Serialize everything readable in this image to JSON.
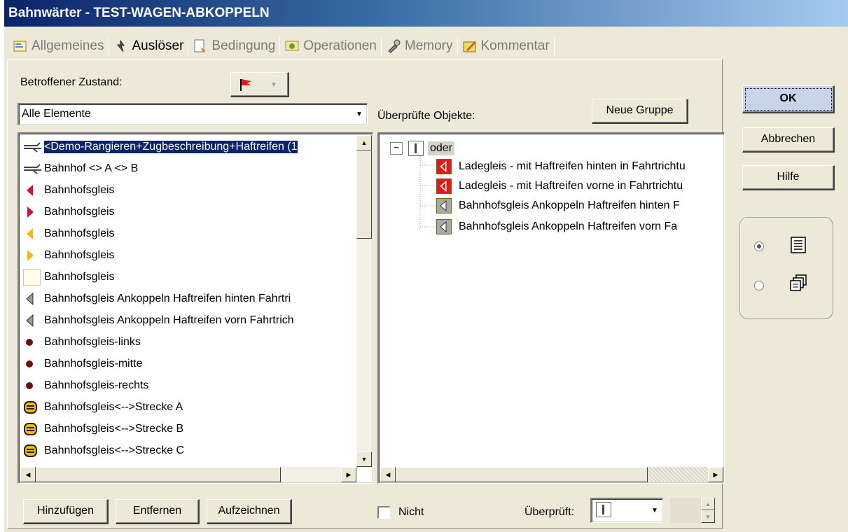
{
  "window": {
    "title": "Bahnwärter - TEST-WAGEN-ABKOPPELN"
  },
  "tabs": [
    {
      "label": "Allgemeines",
      "icon": "properties-icon",
      "active": false
    },
    {
      "label": "Auslöser",
      "icon": "trigger-icon",
      "active": true
    },
    {
      "label": "Bedingung",
      "icon": "condition-icon",
      "active": false
    },
    {
      "label": "Operationen",
      "icon": "operations-icon",
      "active": false
    },
    {
      "label": "Memory",
      "icon": "memory-icon",
      "active": false
    },
    {
      "label": "Kommentar",
      "icon": "comment-icon",
      "active": false
    }
  ],
  "left": {
    "state_label": "Betroffener Zustand:",
    "filter_value": "Alle Elemente",
    "items": [
      {
        "label": "<Demo-Rangieren+Zugbeschreibung+Haftreifen (1",
        "icon": "route-icon",
        "selected": true
      },
      {
        "label": "Bahnhof <> A <> B",
        "icon": "route-icon",
        "selected": false
      },
      {
        "label": "Bahnhofsgleis",
        "icon": "signal-left-red-icon",
        "selected": false
      },
      {
        "label": "Bahnhofsgleis",
        "icon": "signal-right-red-icon",
        "selected": false
      },
      {
        "label": "Bahnhofsgleis",
        "icon": "signal-left-yellow-icon",
        "selected": false
      },
      {
        "label": "Bahnhofsgleis",
        "icon": "signal-right-yellow-icon",
        "selected": false
      },
      {
        "label": "Bahnhofsgleis",
        "icon": "blank-box-icon",
        "selected": false
      },
      {
        "label": "Bahnhofsgleis  Ankoppeln Haftreifen hinten Fahrtri",
        "icon": "signal-left-gray-icon",
        "selected": false
      },
      {
        "label": "Bahnhofsgleis  Ankoppeln Haftreifen vorn Fahrtrich",
        "icon": "signal-left-gray-icon",
        "selected": false
      },
      {
        "label": "Bahnhofsgleis-links",
        "icon": "dot-icon",
        "selected": false
      },
      {
        "label": "Bahnhofsgleis-mitte",
        "icon": "dot-icon",
        "selected": false
      },
      {
        "label": "Bahnhofsgleis-rechts",
        "icon": "dot-icon",
        "selected": false
      },
      {
        "label": "Bahnhofsgleis<-->Strecke A",
        "icon": "block-arrow-icon",
        "selected": false
      },
      {
        "label": "Bahnhofsgleis<-->Strecke B",
        "icon": "block-arrow-icon",
        "selected": false
      },
      {
        "label": "Bahnhofsgleis<-->Strecke C",
        "icon": "block-arrow-icon",
        "selected": false
      }
    ],
    "buttons": {
      "add": "Hinzufügen",
      "remove": "Entfernen",
      "record": "Aufzeichnen"
    }
  },
  "right": {
    "checked_label": "Überprüfte Objekte:",
    "new_group_button": "Neue Gruppe",
    "tree_root": "oder",
    "tree_items": [
      {
        "label": "Ladegleis - mit Haftreifen hinten in Fahrtrichtu",
        "icon": "signal-red-icon"
      },
      {
        "label": "Ladegleis - mit Haftreifen vorne in Fahrtrichtu",
        "icon": "signal-red-icon"
      },
      {
        "label": "Bahnhofsgleis  Ankoppeln Haftreifen hinten F",
        "icon": "signal-gray-icon"
      },
      {
        "label": "Bahnhofsgleis  Ankoppeln Haftreifen vorn Fa",
        "icon": "signal-gray-icon"
      }
    ],
    "not_label": "Nicht",
    "checks_label": "Überprüft:"
  },
  "side": {
    "ok": "OK",
    "cancel": "Abbrechen",
    "help": "Hilfe"
  },
  "colors": {
    "selection": "#0a246a",
    "dialog_bg": "#ece9d8",
    "red": "#e01a1a",
    "yellow": "#f6b90c"
  }
}
